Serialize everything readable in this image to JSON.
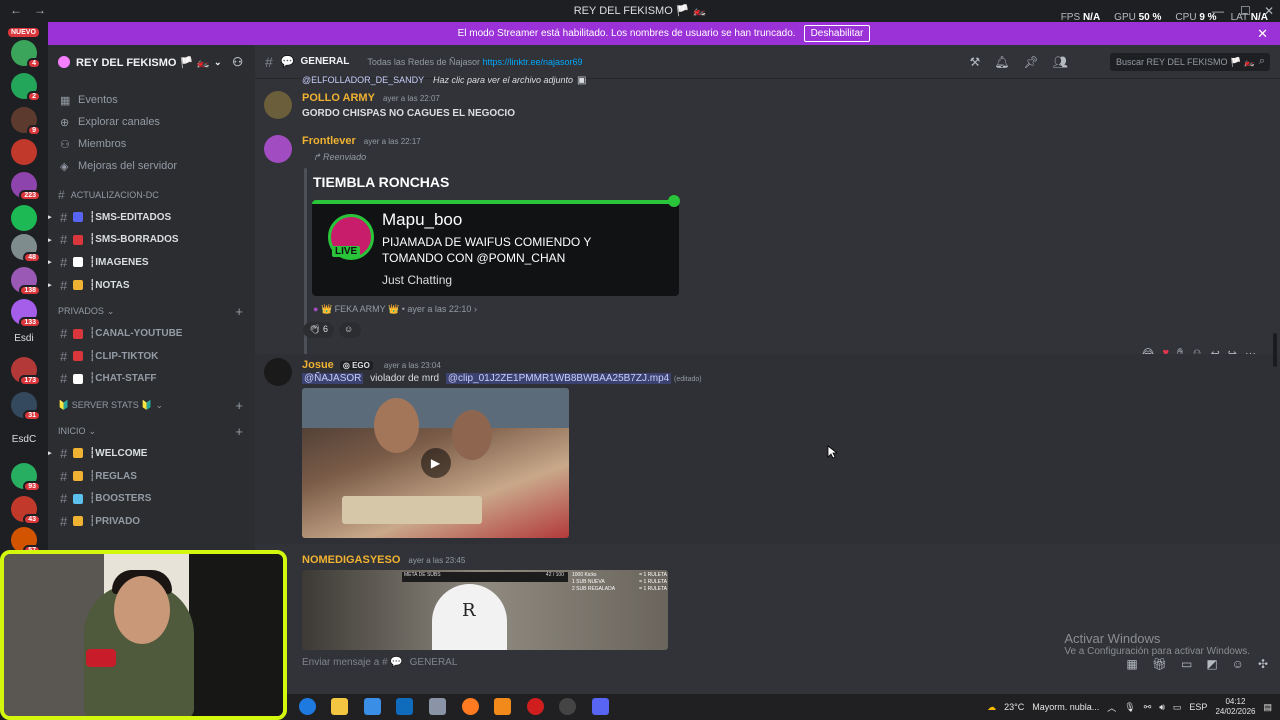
{
  "window": {
    "title": "REY DEL FEKISMO 🏳️ 🏍️",
    "stats": [
      {
        "label": "FPS",
        "value": "N/A"
      },
      {
        "label": "GPU",
        "value": "50 %"
      },
      {
        "label": "CPU",
        "value": "9 %"
      },
      {
        "label": "LAT",
        "value": "N/A"
      }
    ]
  },
  "banner": {
    "text": "El modo Streamer está habilitado. Los nombres de usuario se han truncado.",
    "button": "Deshabilitar"
  },
  "rail": {
    "new_badge": "NUEVO",
    "servers": [
      {
        "badge": "4",
        "color": "#3ba55c"
      },
      {
        "badge": "2",
        "color": "#23a55a"
      },
      {
        "badge": "9",
        "color": "#5c3a2e"
      },
      {
        "badge": "",
        "color": "#c0392b"
      },
      {
        "badge": "223",
        "color": "#8e44ad"
      },
      {
        "badge": "",
        "color": "#1db954"
      },
      {
        "badge": "48",
        "color": "#7f8c8d"
      },
      {
        "badge": "138",
        "color": "#9b59b6"
      },
      {
        "badge": "133",
        "color": "#a55eea"
      },
      {
        "badge": "173",
        "color": "#b33939"
      },
      {
        "badge": "31",
        "color": "#34495e"
      },
      {
        "badge": "93",
        "color": "#27ae60"
      },
      {
        "badge": "43",
        "color": "#c0392b"
      },
      {
        "badge": "57",
        "color": "#d35400"
      }
    ],
    "text_items": [
      "Esdi",
      "EsdC"
    ]
  },
  "sidebar": {
    "server_name": "REY DEL FEKISMO 🏳️ 🏍️",
    "links": [
      {
        "icon": "calendar-icon",
        "label": "Eventos"
      },
      {
        "icon": "compass-icon",
        "label": "Explorar canales"
      },
      {
        "icon": "members-icon",
        "label": "Miembros"
      },
      {
        "icon": "boost-icon",
        "label": "Mejoras del servidor"
      }
    ],
    "categories": [
      {
        "label": "ACTUALIZACION-DC",
        "plus": false,
        "channels": [
          {
            "label": "┆SMS-EDITADOS",
            "color": "#5865f2",
            "bold": true
          },
          {
            "label": "┆SMS-BORRADOS",
            "color": "#da373c",
            "bold": true
          },
          {
            "label": "┆IMAGENES",
            "color": "#ffffff",
            "bold": true
          },
          {
            "label": "┆NOTAS",
            "color": "#f0b232",
            "bold": true
          }
        ]
      },
      {
        "label": "PRIVADOS",
        "plus": true,
        "channels": [
          {
            "label": "┆CANAL-YOUTUBE",
            "color": "#da373c",
            "bold": false
          },
          {
            "label": "┆CLIP-TIKTOK",
            "color": "#da373c",
            "bold": false
          },
          {
            "label": "┆CHAT-STAFF",
            "color": "#ffffff",
            "bold": false
          }
        ]
      },
      {
        "label": "🔰 SERVER STATS 🔰",
        "plus": true,
        "channels": []
      },
      {
        "label": "INICIO",
        "plus": true,
        "channels": [
          {
            "label": "┆WELCOME",
            "color": "#f0b232",
            "bold": true
          },
          {
            "label": "┆REGLAS",
            "color": "#f0b232",
            "bold": false
          },
          {
            "label": "┆BOOSTERS",
            "color": "#5bc0eb",
            "bold": false
          },
          {
            "label": "┆PRIVADO",
            "color": "#f0b232",
            "bold": false
          }
        ]
      }
    ]
  },
  "channel": {
    "name": "GENERAL",
    "topic": "Todas las Redes de Ñajasor",
    "topic_link": "https://linktr.ee/najasor69",
    "search_placeholder": "Buscar REY DEL FEKISMO 🏳️ 🏍️"
  },
  "messages": {
    "reply_preview": {
      "user": "@ELFOLLADOR_DE_SANDY",
      "text": "Haz clic para ver el archivo adjunto"
    },
    "m1": {
      "user": "POLLO ARMY",
      "time": "ayer a las 22:07",
      "text": "GORDO CHISPAS NO CAGUES EL NEGOCIO",
      "color": "#f0b232"
    },
    "m2": {
      "user": "Frontlever",
      "time": "ayer a las 22:17",
      "color": "#f0b232",
      "forwarded": "Reenviado",
      "embed_title": "TIEMBLA RONCHAS",
      "live_label": "LIVE",
      "streamer": "Mapu_boo",
      "stream_title": "PIJAMADA DE WAIFUS COMIENDO Y TOMANDO CON @POMN_CHAN",
      "stream_category": "Just Chatting",
      "origin": "👑 FEKA ARMY 👑",
      "origin_time": "ayer a las 22:10",
      "reaction_count": "6"
    },
    "m3": {
      "user": "Josue",
      "time": "ayer a las 23:04",
      "color": "#f0b232",
      "tag": "EGO",
      "mention": "@ÑAJASOR",
      "text": "violador de mrd",
      "file_link": "@clip_01J2ZE1PMMR1WB8BWBAA25B7ZJ.mp4",
      "edited": "(editado)"
    },
    "m4": {
      "user": "NOMEDIGASYESO",
      "time": "ayer a las 23:45",
      "color": "#f0b232",
      "overlay": {
        "subs": "META DE SUBS",
        "sub_count": "42 / 100",
        "rows": [
          {
            "left": "1000 Kicks",
            "right": "= 1 RULETA"
          },
          {
            "left": "1 SUB NUEVA",
            "right": "= 1 RULETA"
          },
          {
            "left": "2 SUB REGALADA",
            "right": "= 1 RULETA"
          }
        ]
      }
    }
  },
  "composer": {
    "placeholder": "Enviar mensaje a #",
    "channel": "GENERAL"
  },
  "windows_watermark": {
    "line1": "Activar Windows",
    "line2": "Ve a Configuración para activar Windows."
  },
  "taskbar": {
    "weather": "23°C",
    "weather_text": "Mayorm. nubla...",
    "lang": "ESP",
    "time": "04:12",
    "date": "24/02/2026"
  }
}
